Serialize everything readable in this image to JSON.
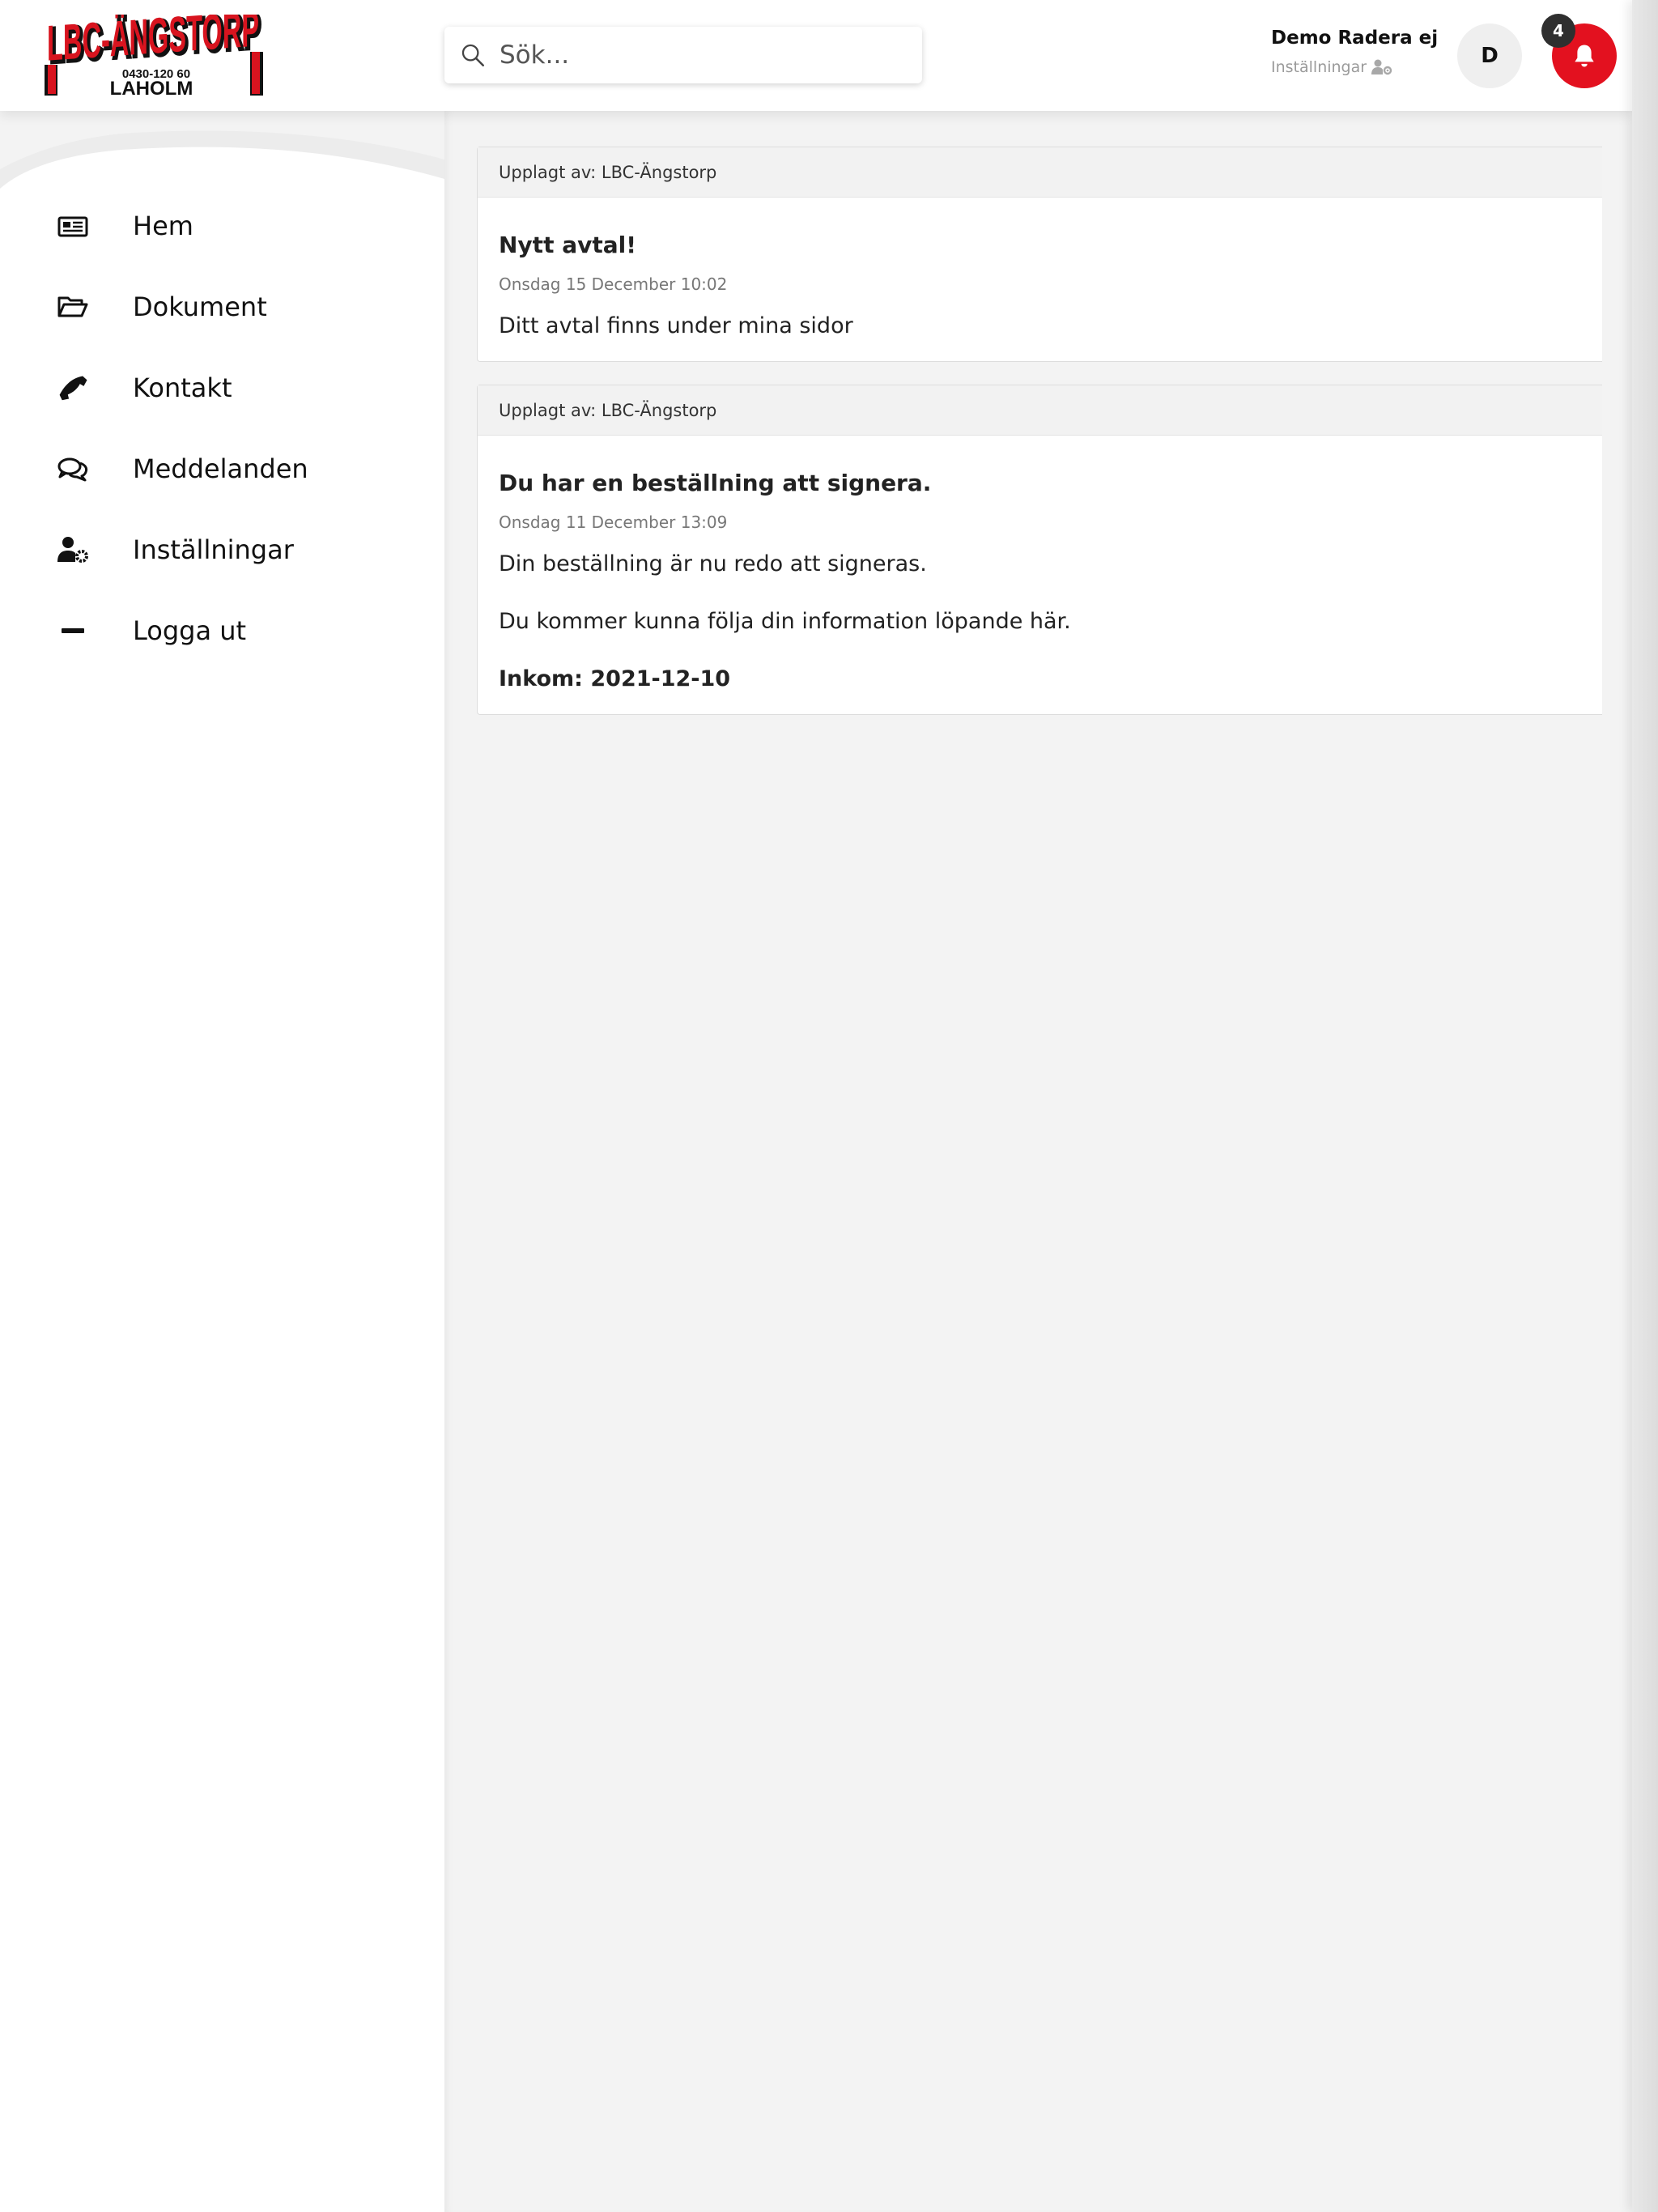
{
  "brand": {
    "logo_name": "LBC-ÄNGSTORP",
    "logo_phone": "0430-120 60",
    "logo_city": "LAHOLM",
    "accent_color": "#e3111f"
  },
  "search": {
    "placeholder": "Sök..."
  },
  "user": {
    "name": "Demo Radera ej",
    "settings_label": "Inställningar",
    "avatar_initial": "D",
    "notification_count": "4"
  },
  "sidebar": {
    "items": [
      {
        "label": "Hem",
        "icon": "newspaper-icon"
      },
      {
        "label": "Dokument",
        "icon": "folder-open-icon"
      },
      {
        "label": "Kontakt",
        "icon": "phone-icon"
      },
      {
        "label": "Meddelanden",
        "icon": "comments-icon"
      },
      {
        "label": "Inställningar",
        "icon": "user-cog-icon"
      },
      {
        "label": "Logga ut",
        "icon": "minus-icon"
      }
    ]
  },
  "feed": [
    {
      "posted_by": "Upplagt av: LBC-Ängstorp",
      "title": "Nytt avtal!",
      "date": "Onsdag 15 December 10:02",
      "paragraphs": [
        "Ditt avtal finns under mina sidor"
      ]
    },
    {
      "posted_by": "Upplagt av: LBC-Ängstorp",
      "title": "Du har en beställning att signera.",
      "date": "Onsdag 11 December 13:09",
      "paragraphs": [
        "Din beställning är nu redo att signeras.",
        "Du kommer kunna följa din information löpande här."
      ],
      "strong": "Inkom: 2021-12-10"
    }
  ]
}
